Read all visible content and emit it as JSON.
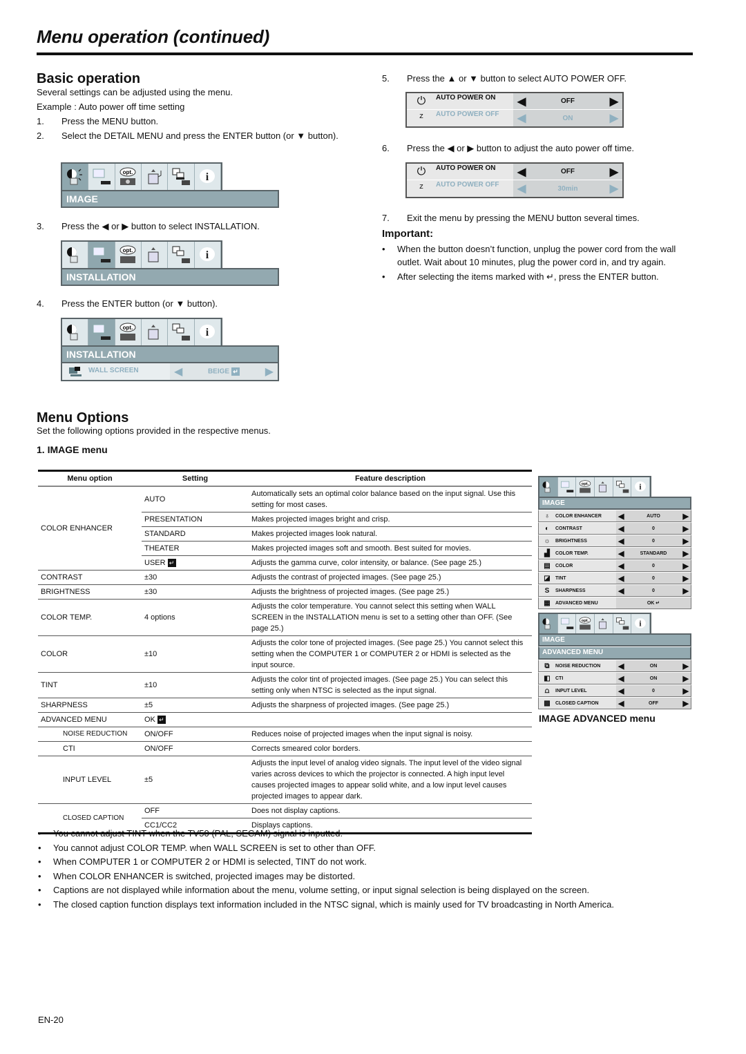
{
  "page": {
    "title": "Menu operation (continued)",
    "page_number": "EN-20"
  },
  "basic": {
    "heading": "Basic operation",
    "intro": "Several settings can be adjusted using the menu.",
    "example": "Example : Auto power off time setting",
    "steps": [
      {
        "n": "1.",
        "text": "Press the MENU button."
      },
      {
        "n": "2.",
        "text": "Select the DETAIL MENU and press the ENTER button  (or ▼ button)."
      },
      {
        "n": "3.",
        "text": "Press the ◀ or ▶ button to select INSTALLATION."
      },
      {
        "n": "4.",
        "text": "Press the ENTER button (or ▼ button)."
      },
      {
        "n": "5.",
        "text": "Press the ▲ or ▼ button to select AUTO POWER OFF."
      },
      {
        "n": "6.",
        "text": "Press the ◀ or ▶ button to adjust the auto power off time."
      },
      {
        "n": "7.",
        "text": "Exit the menu by pressing the MENU button several times."
      }
    ],
    "osd_tabs": [
      "image-tab",
      "installation-tab",
      "opt-tab",
      "signal-tab",
      "network-tab",
      "info-tab"
    ],
    "osd_bar_image": "IMAGE",
    "osd_bar_installation": "INSTALLATION",
    "wall_screen_label": "WALL SCREEN",
    "wall_screen_value": "BEIGE",
    "apo1": {
      "row1_label": "AUTO POWER ON",
      "row1_value": "OFF",
      "row2_label": "AUTO POWER OFF",
      "row2_value": "ON"
    },
    "apo2": {
      "row1_label": "AUTO POWER ON",
      "row1_value": "OFF",
      "row2_label": "AUTO POWER OFF",
      "row2_value": "30min"
    }
  },
  "important": {
    "heading": "Important:",
    "items": [
      "When the button doesn’t function, unplug the power cord from the wall outlet. Wait about 10 minutes, plug the power cord in, and try again.",
      "After selecting the items marked with ↵, press the ENTER button."
    ]
  },
  "menu_options": {
    "heading": "Menu Options",
    "intro": "Set the following options provided in the respective menus.",
    "subheading": "1. IMAGE menu",
    "columns": [
      "Menu option",
      "Setting",
      "Feature description"
    ],
    "rows": [
      {
        "option": "COLOR ENHANCER",
        "setting": "AUTO",
        "desc": "Automatically sets an optimal color balance based on the input signal. Use this setting for most cases."
      },
      {
        "option": "",
        "setting": "PRESENTATION",
        "desc": "Makes projected images bright and crisp."
      },
      {
        "option": "",
        "setting": "STANDARD",
        "desc": "Makes projected images look natural."
      },
      {
        "option": "",
        "setting": "THEATER",
        "desc": "Makes projected images soft and smooth. Best suited for movies."
      },
      {
        "option": "",
        "setting": "USER",
        "desc": "Adjusts the gamma curve, color intensity, or balance. (See page 25.)"
      },
      {
        "option": "CONTRAST",
        "setting": "±30",
        "desc": "Adjusts the contrast of projected images. (See page 25.)"
      },
      {
        "option": "BRIGHTNESS",
        "setting": "±30",
        "desc": "Adjusts the brightness of projected images. (See page 25.)"
      },
      {
        "option": "COLOR TEMP.",
        "setting": "4 options",
        "desc": "Adjusts the color temperature. You cannot select this setting when WALL SCREEN in the INSTALLATION menu is set to a setting other than OFF. (See page 25.)"
      },
      {
        "option": "COLOR",
        "setting": "±10",
        "desc": "Adjusts the color tone of projected images. (See page 25.) You cannot select this setting when the COMPUTER 1 or COMPUTER 2 or HDMI is selected as the input source."
      },
      {
        "option": "TINT",
        "setting": "±10",
        "desc": "Adjusts the color tint of projected images. (See page 25.) You can select this setting only when NTSC is selected as the input signal."
      },
      {
        "option": "SHARPNESS",
        "setting": "±5",
        "desc": "Adjusts the sharpness of projected images. (See page 25.)"
      },
      {
        "option": "ADVANCED MENU",
        "setting": "OK",
        "desc": ""
      },
      {
        "option": "NOISE REDUCTION",
        "setting": "ON/OFF",
        "desc": "Reduces noise of projected images when the input signal is noisy."
      },
      {
        "option": "CTI",
        "setting": "ON/OFF",
        "desc": "Corrects smeared color borders."
      },
      {
        "option": "INPUT LEVEL",
        "setting": "±5",
        "desc": "Adjusts the input level of analog video signals. The input level of the video signal varies across devices to which the projector is connected. A high input level causes projected images to appear solid white, and a low input level causes projected images to appear dark."
      },
      {
        "option": "CLOSED CAPTION",
        "setting": "OFF",
        "desc": "Does not display captions."
      },
      {
        "option": "",
        "setting": "CC1/CC2",
        "desc": "Displays captions."
      }
    ]
  },
  "image_menu_osd": {
    "bar": "IMAGE",
    "rows": [
      {
        "icon": "color-enhancer-icon",
        "glyph": "♁",
        "label": "COLOR ENHANCER",
        "value": "AUTO",
        "arrows": true
      },
      {
        "icon": "contrast-icon",
        "glyph": "◐",
        "label": "CONTRAST",
        "value": "0",
        "arrows": true
      },
      {
        "icon": "brightness-icon",
        "glyph": "☼",
        "label": "BRIGHTNESS",
        "value": "0",
        "arrows": true
      },
      {
        "icon": "color-temp-icon",
        "glyph": "▟",
        "label": "COLOR TEMP.",
        "value": "STANDARD",
        "arrows": true
      },
      {
        "icon": "color-icon",
        "glyph": "▤",
        "label": "COLOR",
        "value": "0",
        "arrows": true
      },
      {
        "icon": "tint-icon",
        "glyph": "◪",
        "label": "TINT",
        "value": "0",
        "arrows": true
      },
      {
        "icon": "sharpness-icon",
        "glyph": "S",
        "label": "SHARPNESS",
        "value": "0",
        "arrows": true
      },
      {
        "icon": "advanced-menu-icon",
        "glyph": "▦",
        "label": "ADVANCED MENU",
        "value": "OK ↵",
        "arrows": false
      }
    ]
  },
  "image_adv_osd": {
    "bar1": "IMAGE",
    "bar2": "ADVANCED MENU",
    "rows": [
      {
        "icon": "noise-reduction-icon",
        "glyph": "⧉",
        "label": "NOISE REDUCTION",
        "value": "ON"
      },
      {
        "icon": "cti-icon",
        "glyph": "◧",
        "label": "CTI",
        "value": "ON"
      },
      {
        "icon": "input-level-icon",
        "glyph": "⩍",
        "label": "INPUT LEVEL",
        "value": "0"
      },
      {
        "icon": "closed-caption-icon",
        "glyph": "▩",
        "label": "CLOSED CAPTION",
        "value": "OFF"
      }
    ],
    "caption": "IMAGE ADVANCED menu"
  },
  "notes": [
    "You cannot adjust TINT when the TV50 (PAL, SECAM) signal is inputted.",
    "You cannot adjust COLOR TEMP. when WALL SCREEN is set to other than OFF.",
    "When COMPUTER 1 or COMPUTER 2 or HDMI is selected, TINT do not work.",
    "When COLOR ENHANCER is switched, projected images may be distorted.",
    "Captions are not displayed while information about the menu, volume setting, or input signal selection is being displayed on the screen.",
    "The closed caption function displays text information included in the NTSC signal, which is mainly used for TV broadcasting in North America."
  ],
  "enter_glyph": "↵",
  "opt_label": "opt.",
  "info_label": "i"
}
